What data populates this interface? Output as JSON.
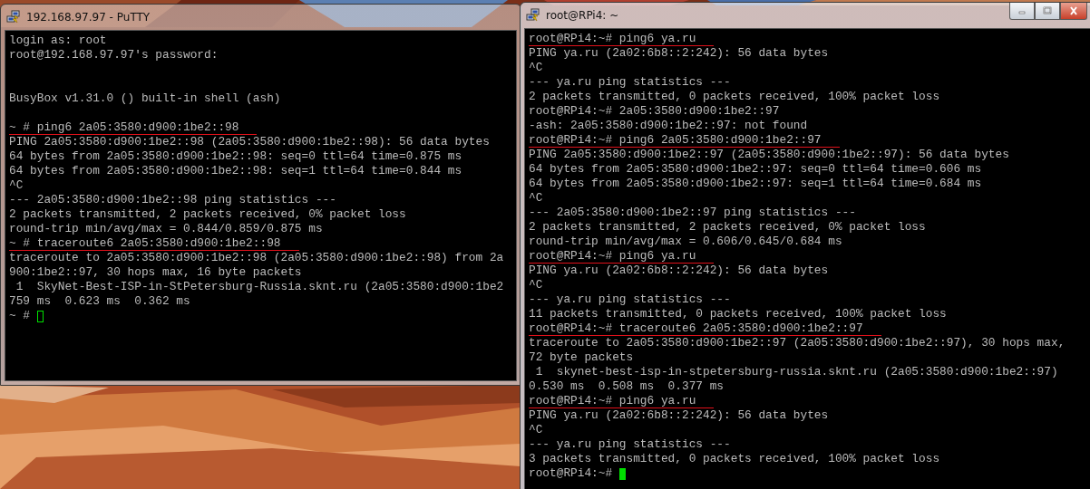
{
  "windows": [
    {
      "title": "192.168.97.97 - PuTTY",
      "active": false,
      "caption_buttons": false,
      "lines": [
        {
          "kind": "text",
          "text": "login as: root",
          "underlined": false
        },
        {
          "kind": "text",
          "text": "root@192.168.97.97's password:",
          "underlined": false
        },
        {
          "kind": "blank"
        },
        {
          "kind": "blank"
        },
        {
          "kind": "text",
          "text": "BusyBox v1.31.0 () built-in shell (ash)",
          "underlined": false
        },
        {
          "kind": "blank"
        },
        {
          "kind": "text",
          "text": "~ # ping6 2a05:3580:d900:1be2::98",
          "underlined": true
        },
        {
          "kind": "text",
          "text": "PING 2a05:3580:d900:1be2::98 (2a05:3580:d900:1be2::98): 56 data bytes",
          "underlined": false
        },
        {
          "kind": "text",
          "text": "64 bytes from 2a05:3580:d900:1be2::98: seq=0 ttl=64 time=0.875 ms",
          "underlined": false
        },
        {
          "kind": "text",
          "text": "64 bytes from 2a05:3580:d900:1be2::98: seq=1 ttl=64 time=0.844 ms",
          "underlined": false
        },
        {
          "kind": "text",
          "text": "^C",
          "underlined": false
        },
        {
          "kind": "text",
          "text": "--- 2a05:3580:d900:1be2::98 ping statistics ---",
          "underlined": false
        },
        {
          "kind": "text",
          "text": "2 packets transmitted, 2 packets received, 0% packet loss",
          "underlined": false
        },
        {
          "kind": "text",
          "text": "round-trip min/avg/max = 0.844/0.859/0.875 ms",
          "underlined": false
        },
        {
          "kind": "text",
          "text": "~ # traceroute6 2a05:3580:d900:1be2::98",
          "underlined": true
        },
        {
          "kind": "text",
          "text": "traceroute to 2a05:3580:d900:1be2::98 (2a05:3580:d900:1be2::98) from 2a",
          "underlined": false
        },
        {
          "kind": "text",
          "text": "900:1be2::97, 30 hops max, 16 byte packets",
          "underlined": false
        },
        {
          "kind": "text",
          "text": " 1  SkyNet-Best-ISP-in-StPetersburg-Russia.sknt.ru (2a05:3580:d900:1be2",
          "underlined": false
        },
        {
          "kind": "text",
          "text": "759 ms  0.623 ms  0.362 ms",
          "underlined": false
        },
        {
          "kind": "prompt",
          "text": "~ #",
          "underlined": false
        }
      ]
    },
    {
      "title": "root@RPi4: ~",
      "active": true,
      "caption_buttons": true,
      "lines": [
        {
          "kind": "text",
          "text": "root@RPi4:~# ping6 ya.ru",
          "underlined": true
        },
        {
          "kind": "text",
          "text": "PING ya.ru (2a02:6b8::2:242): 56 data bytes",
          "underlined": false
        },
        {
          "kind": "text",
          "text": "^C",
          "underlined": false
        },
        {
          "kind": "text",
          "text": "--- ya.ru ping statistics ---",
          "underlined": false
        },
        {
          "kind": "text",
          "text": "2 packets transmitted, 0 packets received, 100% packet loss",
          "underlined": false
        },
        {
          "kind": "text",
          "text": "root@RPi4:~# 2a05:3580:d900:1be2::97",
          "underlined": false
        },
        {
          "kind": "text",
          "text": "-ash: 2a05:3580:d900:1be2::97: not found",
          "underlined": false
        },
        {
          "kind": "text",
          "text": "root@RPi4:~# ping6 2a05:3580:d900:1be2::97",
          "underlined": true
        },
        {
          "kind": "text",
          "text": "PING 2a05:3580:d900:1be2::97 (2a05:3580:d900:1be2::97): 56 data bytes",
          "underlined": false
        },
        {
          "kind": "text",
          "text": "64 bytes from 2a05:3580:d900:1be2::97: seq=0 ttl=64 time=0.606 ms",
          "underlined": false
        },
        {
          "kind": "text",
          "text": "64 bytes from 2a05:3580:d900:1be2::97: seq=1 ttl=64 time=0.684 ms",
          "underlined": false
        },
        {
          "kind": "text",
          "text": "^C",
          "underlined": false
        },
        {
          "kind": "text",
          "text": "--- 2a05:3580:d900:1be2::97 ping statistics ---",
          "underlined": false
        },
        {
          "kind": "text",
          "text": "2 packets transmitted, 2 packets received, 0% packet loss",
          "underlined": false
        },
        {
          "kind": "text",
          "text": "round-trip min/avg/max = 0.606/0.645/0.684 ms",
          "underlined": false
        },
        {
          "kind": "text",
          "text": "root@RPi4:~# ping6 ya.ru",
          "underlined": true
        },
        {
          "kind": "text",
          "text": "PING ya.ru (2a02:6b8::2:242): 56 data bytes",
          "underlined": false
        },
        {
          "kind": "text",
          "text": "^C",
          "underlined": false
        },
        {
          "kind": "text",
          "text": "--- ya.ru ping statistics ---",
          "underlined": false
        },
        {
          "kind": "text",
          "text": "11 packets transmitted, 0 packets received, 100% packet loss",
          "underlined": false
        },
        {
          "kind": "text",
          "text": "root@RPi4:~# traceroute6 2a05:3580:d900:1be2::97",
          "underlined": true
        },
        {
          "kind": "text",
          "text": "traceroute to 2a05:3580:d900:1be2::97 (2a05:3580:d900:1be2::97), 30 hops max,",
          "underlined": false
        },
        {
          "kind": "text",
          "text": "72 byte packets",
          "underlined": false
        },
        {
          "kind": "text",
          "text": " 1  skynet-best-isp-in-stpetersburg-russia.sknt.ru (2a05:3580:d900:1be2::97)",
          "underlined": false
        },
        {
          "kind": "text",
          "text": "0.530 ms  0.508 ms  0.377 ms",
          "underlined": false
        },
        {
          "kind": "text",
          "text": "root@RPi4:~# ping6 ya.ru",
          "underlined": true
        },
        {
          "kind": "text",
          "text": "PING ya.ru (2a02:6b8::2:242): 56 data bytes",
          "underlined": false
        },
        {
          "kind": "text",
          "text": "^C",
          "underlined": false
        },
        {
          "kind": "text",
          "text": "--- ya.ru ping statistics ---",
          "underlined": false
        },
        {
          "kind": "text",
          "text": "3 packets transmitted, 0 packets received, 100% packet loss",
          "underlined": false
        },
        {
          "kind": "prompt",
          "text": "root@RPi4:~#",
          "underlined": false
        }
      ]
    }
  ]
}
